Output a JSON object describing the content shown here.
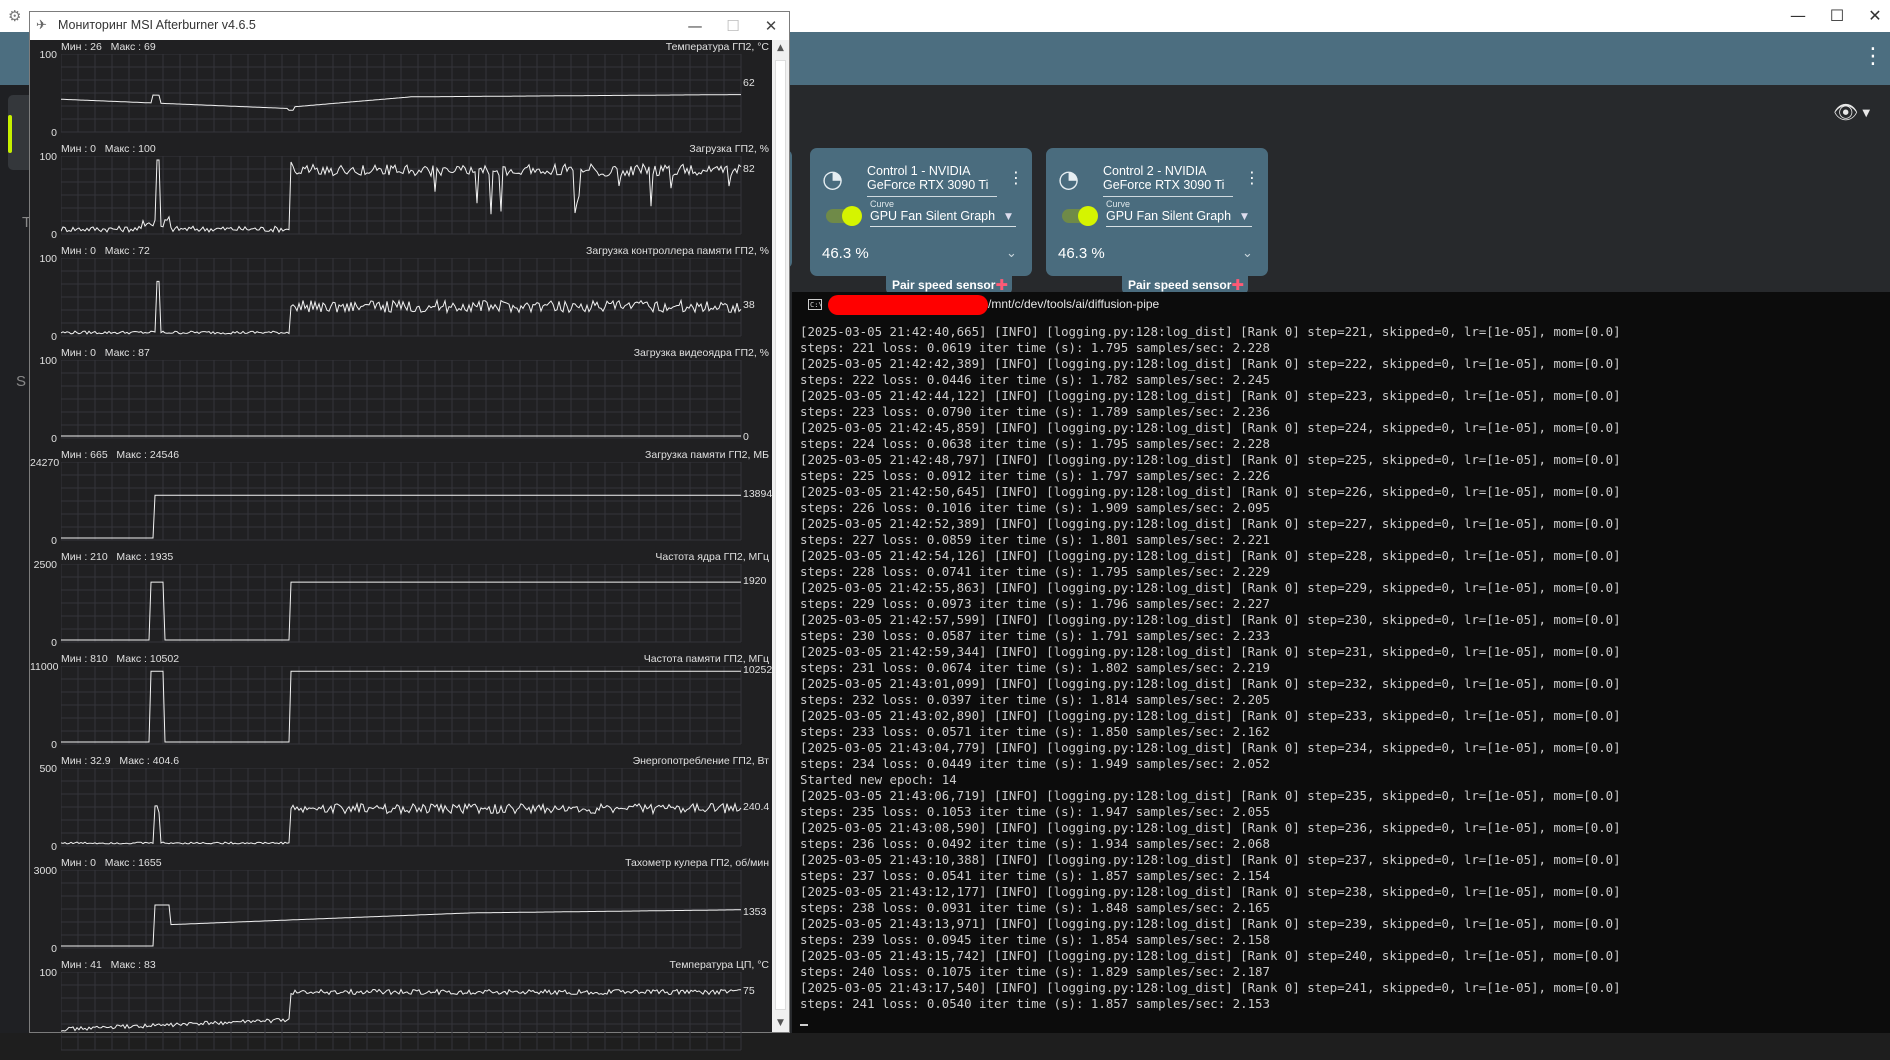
{
  "background_app": {
    "sidebar_letters": [
      "Т",
      "S"
    ],
    "cards": [
      {
        "title": "Control 1 - NVIDIA GeForce RTX 3090 Ti",
        "curve_label": "Curve",
        "curve_value": "GPU Fan Silent Graph",
        "percent": "46.3 %",
        "pair_button": "Pair speed sensor"
      },
      {
        "title": "Control 2 - NVIDIA GeForce RTX 3090 Ti",
        "curve_label": "Curve",
        "curve_value": "GPU Fan Silent Graph",
        "percent": "46.3 %",
        "pair_button": "Pair speed sensor"
      }
    ],
    "accent_color": "#c6f000",
    "card_color": "#4a6c7e"
  },
  "afterburner": {
    "title": "Мониторинг MSI Afterburner v4.6.5",
    "graphs": [
      {
        "label": "Температура ГП2, °C",
        "min": "26",
        "max": "69",
        "ymax": "100",
        "ymin": "0",
        "current": "62",
        "current_value": 62,
        "scale_max": 100,
        "shape": "temp"
      },
      {
        "label": "Загрузка ГП2, %",
        "min": "0",
        "max": "100",
        "ymax": "100",
        "ymin": "0",
        "current": "82",
        "current_value": 82,
        "scale_max": 100,
        "shape": "noisy_high"
      },
      {
        "label": "Загрузка контроллера памяти ГП2, %",
        "min": "0",
        "max": "72",
        "ymax": "100",
        "ymin": "0",
        "current": "38",
        "current_value": 38,
        "scale_max": 100,
        "shape": "noisy_mid"
      },
      {
        "label": "Загрузка видеоядра ГП2, %",
        "min": "0",
        "max": "87",
        "ymax": "100",
        "ymin": "0",
        "current": "0",
        "current_value": 0,
        "scale_max": 100,
        "shape": "flat_zero"
      },
      {
        "label": "Загрузка памяти ГП2, МБ",
        "min": "665",
        "max": "24546",
        "ymax": "24270",
        "ymin": "0",
        "current": "13894",
        "current_value": 13894,
        "scale_max": 24270,
        "shape": "step"
      },
      {
        "label": "Частота ядра ГП2, МГц",
        "min": "210",
        "max": "1935",
        "ymax": "2500",
        "ymin": "0",
        "current": "1920",
        "current_value": 1920,
        "scale_max": 2500,
        "shape": "clock"
      },
      {
        "label": "Частота памяти ГП2, МГц",
        "min": "810",
        "max": "10502",
        "ymax": "11000",
        "ymin": "0",
        "current": "10252",
        "current_value": 10252,
        "scale_max": 11000,
        "shape": "clock"
      },
      {
        "label": "Энергопотребление ГП2, Вт",
        "min": "32.9",
        "max": "404.6",
        "ymax": "500",
        "ymin": "0",
        "current": "240.4",
        "current_value": 240.4,
        "scale_max": 500,
        "shape": "power"
      },
      {
        "label": "Тахометр кулера ГП2, об/мин",
        "min": "0",
        "max": "1655",
        "ymax": "3000",
        "ymin": "0",
        "current": "1353",
        "current_value": 1353,
        "scale_max": 3000,
        "shape": "fan"
      },
      {
        "label": "Температура ЦП, °C",
        "min": "41",
        "max": "83",
        "ymax": "100",
        "ymin": "",
        "current": "75",
        "current_value": 75,
        "scale_max": 100,
        "shape": "cpu"
      }
    ]
  },
  "terminal": {
    "tab_path": "/mnt/c/dev/tools/ai/diffusion-pipe",
    "lines": [
      "[2025-03-05 21:42:40,665] [INFO] [logging.py:128:log_dist] [Rank 0] step=221, skipped=0, lr=[1e-05], mom=[0.0]",
      "steps: 221 loss: 0.0619 iter time (s): 1.795 samples/sec: 2.228",
      "[2025-03-05 21:42:42,389] [INFO] [logging.py:128:log_dist] [Rank 0] step=222, skipped=0, lr=[1e-05], mom=[0.0]",
      "steps: 222 loss: 0.0446 iter time (s): 1.782 samples/sec: 2.245",
      "[2025-03-05 21:42:44,122] [INFO] [logging.py:128:log_dist] [Rank 0] step=223, skipped=0, lr=[1e-05], mom=[0.0]",
      "steps: 223 loss: 0.0790 iter time (s): 1.789 samples/sec: 2.236",
      "[2025-03-05 21:42:45,859] [INFO] [logging.py:128:log_dist] [Rank 0] step=224, skipped=0, lr=[1e-05], mom=[0.0]",
      "steps: 224 loss: 0.0638 iter time (s): 1.795 samples/sec: 2.228",
      "[2025-03-05 21:42:48,797] [INFO] [logging.py:128:log_dist] [Rank 0] step=225, skipped=0, lr=[1e-05], mom=[0.0]",
      "steps: 225 loss: 0.0912 iter time (s): 1.797 samples/sec: 2.226",
      "[2025-03-05 21:42:50,645] [INFO] [logging.py:128:log_dist] [Rank 0] step=226, skipped=0, lr=[1e-05], mom=[0.0]",
      "steps: 226 loss: 0.1016 iter time (s): 1.909 samples/sec: 2.095",
      "[2025-03-05 21:42:52,389] [INFO] [logging.py:128:log_dist] [Rank 0] step=227, skipped=0, lr=[1e-05], mom=[0.0]",
      "steps: 227 loss: 0.0859 iter time (s): 1.801 samples/sec: 2.221",
      "[2025-03-05 21:42:54,126] [INFO] [logging.py:128:log_dist] [Rank 0] step=228, skipped=0, lr=[1e-05], mom=[0.0]",
      "steps: 228 loss: 0.0741 iter time (s): 1.795 samples/sec: 2.229",
      "[2025-03-05 21:42:55,863] [INFO] [logging.py:128:log_dist] [Rank 0] step=229, skipped=0, lr=[1e-05], mom=[0.0]",
      "steps: 229 loss: 0.0973 iter time (s): 1.796 samples/sec: 2.227",
      "[2025-03-05 21:42:57,599] [INFO] [logging.py:128:log_dist] [Rank 0] step=230, skipped=0, lr=[1e-05], mom=[0.0]",
      "steps: 230 loss: 0.0587 iter time (s): 1.791 samples/sec: 2.233",
      "[2025-03-05 21:42:59,344] [INFO] [logging.py:128:log_dist] [Rank 0] step=231, skipped=0, lr=[1e-05], mom=[0.0]",
      "steps: 231 loss: 0.0674 iter time (s): 1.802 samples/sec: 2.219",
      "[2025-03-05 21:43:01,099] [INFO] [logging.py:128:log_dist] [Rank 0] step=232, skipped=0, lr=[1e-05], mom=[0.0]",
      "steps: 232 loss: 0.0397 iter time (s): 1.814 samples/sec: 2.205",
      "[2025-03-05 21:43:02,890] [INFO] [logging.py:128:log_dist] [Rank 0] step=233, skipped=0, lr=[1e-05], mom=[0.0]",
      "steps: 233 loss: 0.0571 iter time (s): 1.850 samples/sec: 2.162",
      "[2025-03-05 21:43:04,779] [INFO] [logging.py:128:log_dist] [Rank 0] step=234, skipped=0, lr=[1e-05], mom=[0.0]",
      "steps: 234 loss: 0.0449 iter time (s): 1.949 samples/sec: 2.052",
      "Started new epoch: 14",
      "[2025-03-05 21:43:06,719] [INFO] [logging.py:128:log_dist] [Rank 0] step=235, skipped=0, lr=[1e-05], mom=[0.0]",
      "steps: 235 loss: 0.1053 iter time (s): 1.947 samples/sec: 2.055",
      "[2025-03-05 21:43:08,590] [INFO] [logging.py:128:log_dist] [Rank 0] step=236, skipped=0, lr=[1e-05], mom=[0.0]",
      "steps: 236 loss: 0.0492 iter time (s): 1.934 samples/sec: 2.068",
      "[2025-03-05 21:43:10,388] [INFO] [logging.py:128:log_dist] [Rank 0] step=237, skipped=0, lr=[1e-05], mom=[0.0]",
      "steps: 237 loss: 0.0541 iter time (s): 1.857 samples/sec: 2.154",
      "[2025-03-05 21:43:12,177] [INFO] [logging.py:128:log_dist] [Rank 0] step=238, skipped=0, lr=[1e-05], mom=[0.0]",
      "steps: 238 loss: 0.0931 iter time (s): 1.848 samples/sec: 2.165",
      "[2025-03-05 21:43:13,971] [INFO] [logging.py:128:log_dist] [Rank 0] step=239, skipped=0, lr=[1e-05], mom=[0.0]",
      "steps: 239 loss: 0.0945 iter time (s): 1.854 samples/sec: 2.158",
      "[2025-03-05 21:43:15,742] [INFO] [logging.py:128:log_dist] [Rank 0] step=240, skipped=0, lr=[1e-05], mom=[0.0]",
      "steps: 240 loss: 0.1075 iter time (s): 1.829 samples/sec: 2.187",
      "[2025-03-05 21:43:17,540] [INFO] [logging.py:128:log_dist] [Rank 0] step=241, skipped=0, lr=[1e-05], mom=[0.0]",
      "steps: 241 loss: 0.0540 iter time (s): 1.857 samples/sec: 2.153"
    ]
  }
}
